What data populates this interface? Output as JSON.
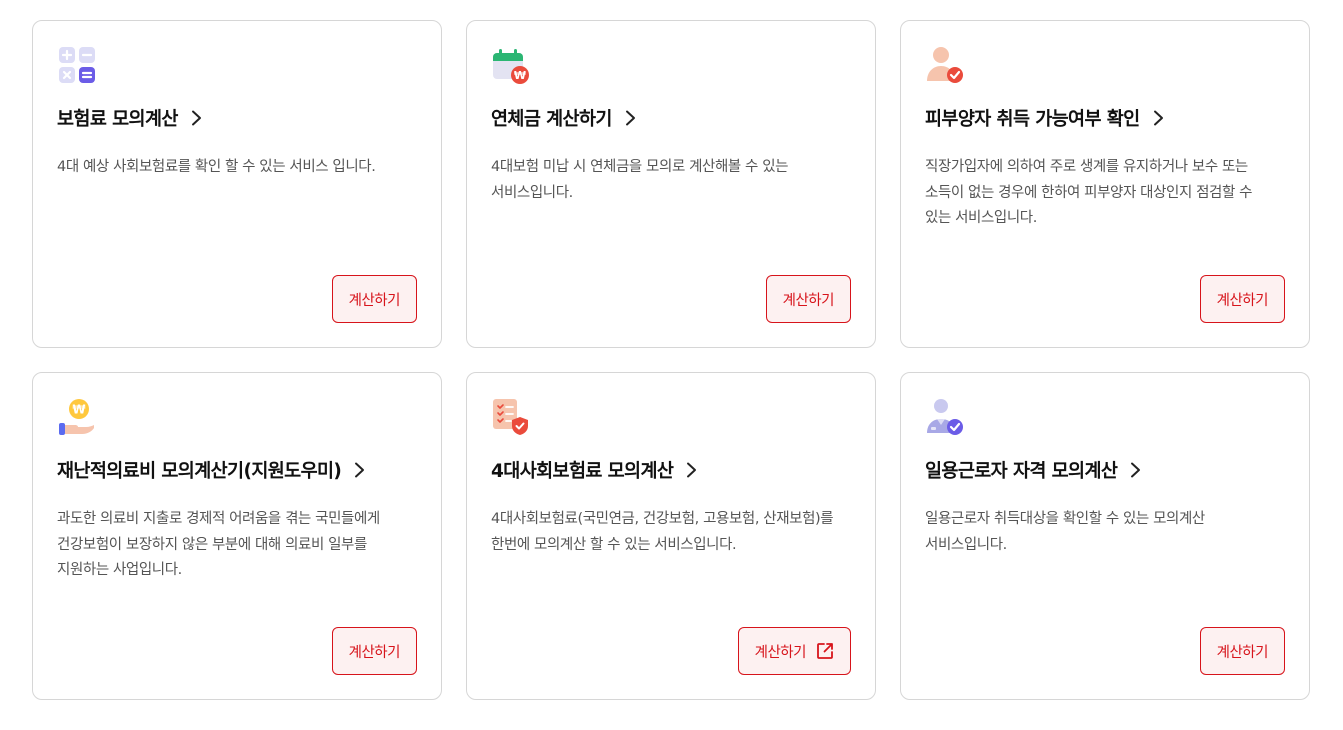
{
  "cards": [
    {
      "title": "보험료 모의계산",
      "desc": "4대 예상 사회보험료를 확인 할 수 있는 서비스 입니다.",
      "button": "계산하기",
      "icon": "calculator-icon"
    },
    {
      "title": "연체금 계산하기",
      "desc": "4대보험 미납 시 연체금을 모의로 계산해볼 수 있는 서비스입니다.",
      "button": "계산하기",
      "icon": "calendar-won-icon"
    },
    {
      "title": "피부양자 취득 가능여부 확인",
      "desc": "직장가입자에 의하여 주로 생계를 유지하거나 보수 또는 소득이 없는 경우에 한하여 피부양자 대상인지 점검할 수 있는 서비스입니다.",
      "button": "계산하기",
      "icon": "person-check-icon"
    },
    {
      "title": "재난적의료비 모의계산기(지원도우미)",
      "desc": "과도한 의료비 지출로 경제적 어려움을 겪는 국민들에게 건강보험이 보장하지 않은 부분에 대해 의료비 일부를 지원하는 사업입니다.",
      "button": "계산하기",
      "icon": "hand-coin-icon"
    },
    {
      "title": "4대사회보험료 모의계산",
      "desc": "4대사회보험료(국민연금, 건강보험, 고용보험, 산재보험)를 한번에 모의계산 할 수 있는 서비스입니다.",
      "button": "계산하기",
      "icon": "document-shield-icon",
      "external": true
    },
    {
      "title": "일용근로자 자격 모의계산",
      "desc": "일용근로자 취득대상을 확인할 수 있는 모의계산 서비스입니다.",
      "button": "계산하기",
      "icon": "worker-check-icon"
    }
  ],
  "colors": {
    "accent": "#d7141b",
    "button_bg": "#fdf1f1",
    "border": "#d6d6d6"
  }
}
